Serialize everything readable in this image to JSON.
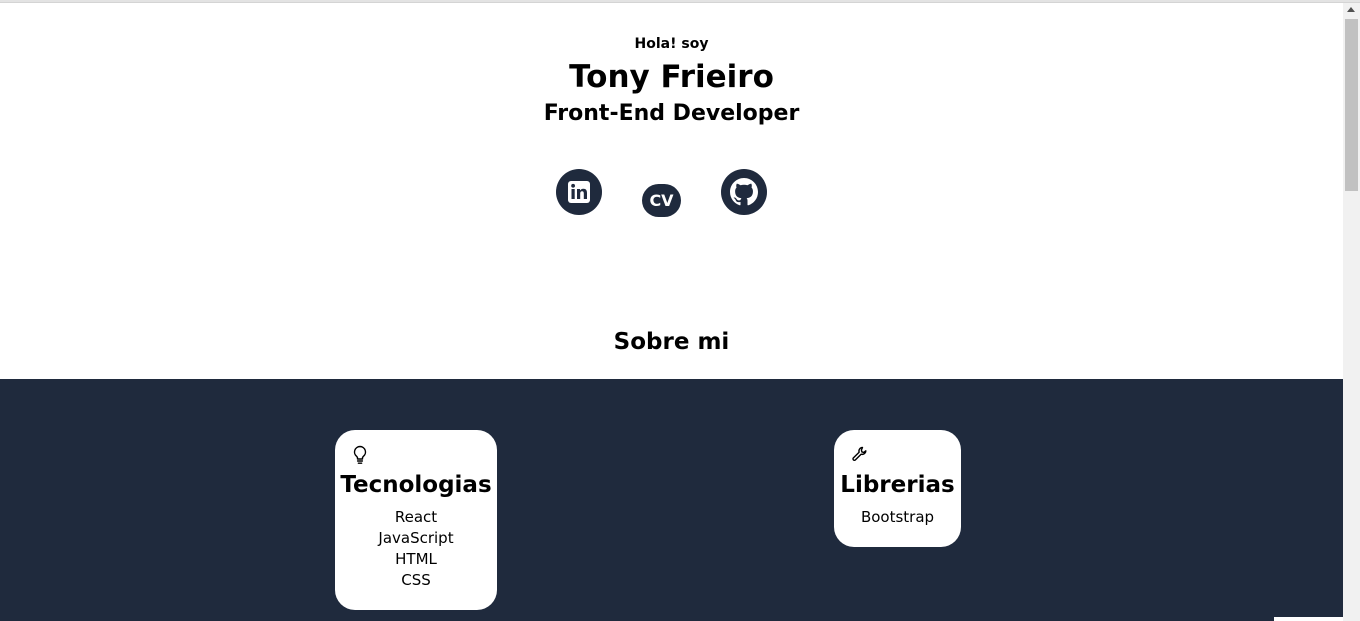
{
  "hero": {
    "greeting": "Hola! soy",
    "name": "Tony Frieiro",
    "role": "Front-End Developer"
  },
  "social": {
    "linkedin_icon": "linkedin-icon",
    "cv_label": "CV",
    "github_icon": "github-icon"
  },
  "about": {
    "title": "Sobre mi"
  },
  "cards": {
    "tech": {
      "icon": "lightbulb-icon",
      "title": "Tecnologias",
      "items": [
        "React",
        "JavaScript",
        "HTML",
        "CSS"
      ]
    },
    "libs": {
      "icon": "wrench-icon",
      "title": "Librerias",
      "items": [
        "Bootstrap"
      ]
    }
  },
  "colors": {
    "dark": "#1f2a3d",
    "card": "#ffffff"
  }
}
